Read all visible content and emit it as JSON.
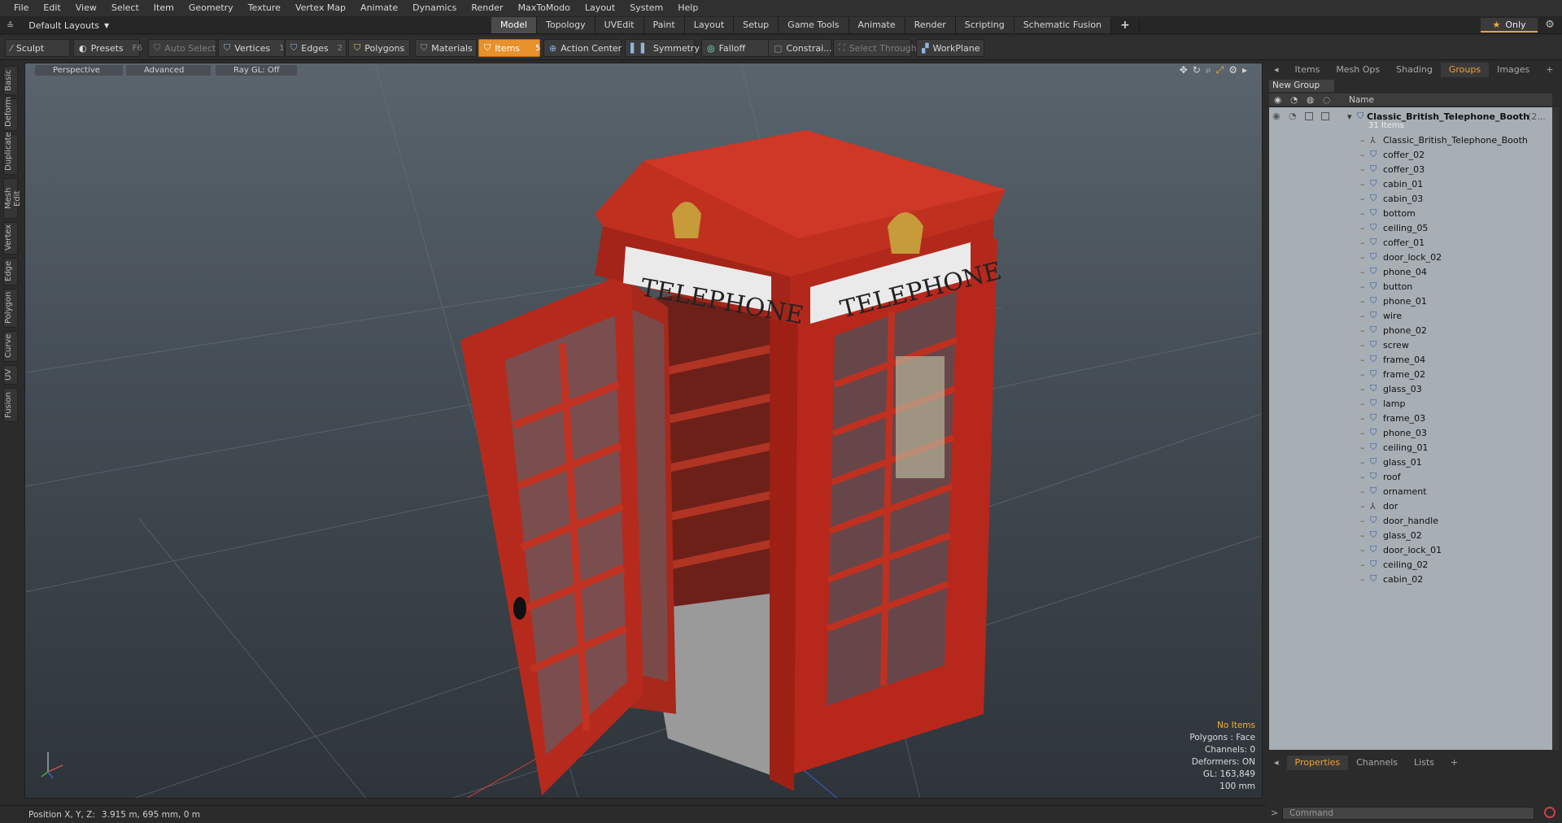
{
  "menu": [
    "File",
    "Edit",
    "View",
    "Select",
    "Item",
    "Geometry",
    "Texture",
    "Vertex Map",
    "Animate",
    "Dynamics",
    "Render",
    "MaxToModo",
    "Layout",
    "System",
    "Help"
  ],
  "layout_selector": "Default Layouts",
  "tabs": [
    "Model",
    "Topology",
    "UVEdit",
    "Paint",
    "Layout",
    "Setup",
    "Game Tools",
    "Animate",
    "Render",
    "Scripting",
    "Schematic Fusion"
  ],
  "active_tab": "Model",
  "only_label": "Only",
  "toolbar": {
    "sculpt": "Sculpt",
    "presets": "Presets",
    "presets_key": "F6",
    "auto_select": "Auto Select",
    "vertices": "Vertices",
    "vertices_key": "1",
    "edges": "Edges",
    "edges_key": "2",
    "polygons": "Polygons",
    "materials": "Materials",
    "items": "Items",
    "items_key": "5",
    "action_center": "Action Center",
    "symmetry": "Symmetry",
    "falloff": "Falloff",
    "constraints": "Constrai...",
    "select_through": "Select Through",
    "workplane": "WorkPlane"
  },
  "left_tabs": [
    "Basic",
    "Deform",
    "Duplicate",
    "Mesh Edit",
    "Vertex",
    "Edge",
    "Polygon",
    "Curve",
    "UV",
    "Fusion"
  ],
  "viewport": {
    "view_mode": "Perspective",
    "shading": "Advanced",
    "raygl": "Ray GL: Off",
    "info": {
      "no_items": "No Items",
      "polygons": "Polygons : Face",
      "channels": "Channels: 0",
      "deformers": "Deformers: ON",
      "gl": "GL: 163,849",
      "scale": "100 mm"
    },
    "booth_signs": [
      "TELEPHONE",
      "TELEPHONE"
    ]
  },
  "status": {
    "position_label": "Position X, Y, Z:",
    "position_value": "3.915 m, 695 mm, 0 m"
  },
  "right_panel": {
    "tabs": [
      "Items",
      "Mesh Ops",
      "Shading",
      "Groups",
      "Images"
    ],
    "active_tab": "Groups",
    "new_group": "New Group",
    "name_header": "Name",
    "root": {
      "name": "Classic_British_Telephone_Booth",
      "suffix": "(2...",
      "count": "31 Items"
    },
    "items": [
      {
        "name": "Classic_British_Telephone_Booth",
        "type": "locator"
      },
      {
        "name": "coffer_02",
        "type": "mesh"
      },
      {
        "name": "coffer_03",
        "type": "mesh"
      },
      {
        "name": "cabin_01",
        "type": "mesh"
      },
      {
        "name": "cabin_03",
        "type": "mesh"
      },
      {
        "name": "bottom",
        "type": "mesh"
      },
      {
        "name": "ceiling_05",
        "type": "mesh"
      },
      {
        "name": "coffer_01",
        "type": "mesh"
      },
      {
        "name": "door_lock_02",
        "type": "mesh"
      },
      {
        "name": "phone_04",
        "type": "mesh"
      },
      {
        "name": "button",
        "type": "mesh"
      },
      {
        "name": "phone_01",
        "type": "mesh"
      },
      {
        "name": "wire",
        "type": "mesh"
      },
      {
        "name": "phone_02",
        "type": "mesh"
      },
      {
        "name": "screw",
        "type": "mesh"
      },
      {
        "name": "frame_04",
        "type": "mesh"
      },
      {
        "name": "frame_02",
        "type": "mesh"
      },
      {
        "name": "glass_03",
        "type": "mesh"
      },
      {
        "name": "lamp",
        "type": "mesh"
      },
      {
        "name": "frame_03",
        "type": "mesh"
      },
      {
        "name": "phone_03",
        "type": "mesh"
      },
      {
        "name": "ceiling_01",
        "type": "mesh"
      },
      {
        "name": "glass_01",
        "type": "mesh"
      },
      {
        "name": "roof",
        "type": "mesh"
      },
      {
        "name": "ornament",
        "type": "mesh"
      },
      {
        "name": "dor",
        "type": "locator"
      },
      {
        "name": "door_handle",
        "type": "mesh"
      },
      {
        "name": "glass_02",
        "type": "mesh"
      },
      {
        "name": "door_lock_01",
        "type": "mesh"
      },
      {
        "name": "ceiling_02",
        "type": "mesh"
      },
      {
        "name": "cabin_02",
        "type": "mesh"
      }
    ],
    "bottom_tabs": [
      "Properties",
      "Channels",
      "Lists"
    ],
    "bottom_active": "Properties",
    "command_placeholder": "Command"
  },
  "colors": {
    "accent": "#e8912c",
    "booth_red": "#b8271c",
    "tree_bg": "#a7aeb4"
  }
}
